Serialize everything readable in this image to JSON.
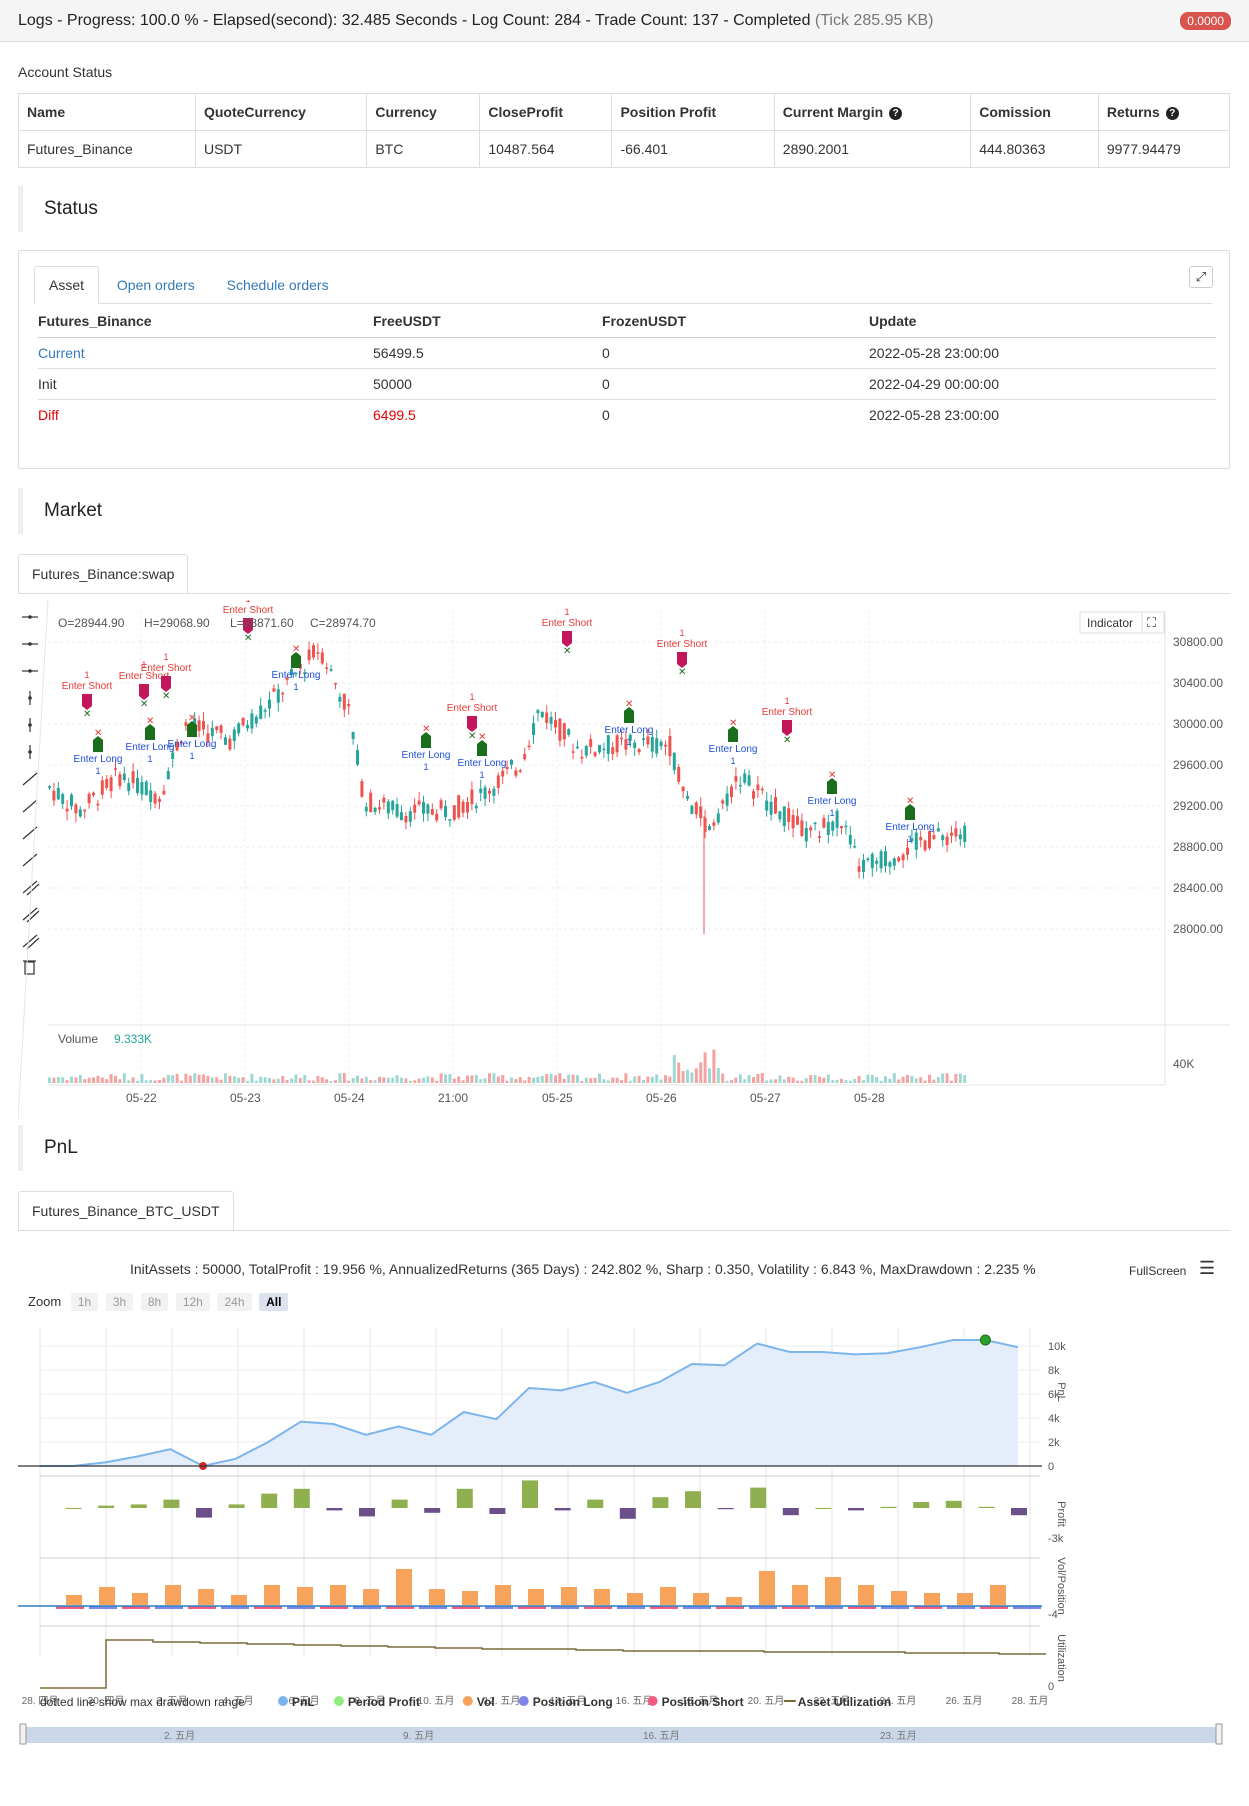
{
  "header": {
    "title": "Logs - Progress: 100.0 % - Elapsed(second): 32.485 Seconds - Log Count: 284 - Trade Count: 137 - Completed",
    "tick": "(Tick 285.95 KB)",
    "badge": "0.0000"
  },
  "account": {
    "label": "Account Status",
    "columns": [
      "Name",
      "QuoteCurrency",
      "Currency",
      "CloseProfit",
      "Position Profit",
      "Current Margin",
      "Comission",
      "Returns"
    ],
    "row": [
      "Futures_Binance",
      "USDT",
      "BTC",
      "10487.564",
      "-66.401",
      "2890.2001",
      "444.80363",
      "9977.94479"
    ]
  },
  "status": {
    "title": "Status",
    "tabs": [
      "Asset",
      "Open orders",
      "Schedule orders"
    ],
    "columns": [
      "Futures_Binance",
      "FreeUSDT",
      "FrozenUSDT",
      "Update"
    ],
    "rows": [
      [
        "Current",
        "56499.5",
        "0",
        "2022-05-28 23:00:00"
      ],
      [
        "Init",
        "50000",
        "0",
        "2022-04-29 00:00:00"
      ],
      [
        "Diff",
        "6499.5",
        "0",
        "2022-05-28 23:00:00"
      ]
    ],
    "colors": {
      "current": "#337ab7",
      "diff": "#e00000"
    }
  },
  "market": {
    "title": "Market",
    "tab": "Futures_Binance:swap",
    "ohlc": {
      "o": "O=28944.90",
      "h": "H=29068.90",
      "l": "L=28871.60",
      "c": "C=28974.70"
    },
    "indicator_label": "Indicator",
    "volume_label": "Volume",
    "volume_value": "9.333K",
    "price_ticks": [
      "30800.00",
      "30400.00",
      "30000.00",
      "29600.00",
      "29200.00",
      "28800.00",
      "28400.00",
      "28000.00"
    ],
    "volume_tick": "40K",
    "date_ticks": [
      "05-22",
      "05-23",
      "05-24",
      "21:00",
      "05-25",
      "05-26",
      "05-27",
      "05-28"
    ],
    "enter_short": "Enter Short",
    "enter_long": "Enter Long",
    "qty": "1",
    "colors": {
      "up": "#26a69a",
      "down": "#ef5350",
      "short_marker": "#c2185b",
      "long_marker": "#1b6e1b"
    }
  },
  "pnl": {
    "title": "PnL",
    "tab": "Futures_Binance_BTC_USDT",
    "summary": "InitAssets : 50000, TotalProfit : 19.956 %, AnnualizedReturns (365 Days) : 242.802 %, Sharp : 0.350, Volatility : 6.843 %, MaxDrawdown : 2.235 %",
    "fullscreen": "FullScreen",
    "zoom_label": "Zoom",
    "zoom_buttons": [
      "1h",
      "3h",
      "8h",
      "12h",
      "24h",
      "All"
    ],
    "y_ticks_pnl": [
      "10k",
      "8k",
      "6k",
      "4k",
      "2k",
      "0"
    ],
    "y_tick_profit": "-3k",
    "y_tick_vol": "-4",
    "y_tick_util": "0",
    "axis_titles": [
      "PnL",
      "Profit",
      "Vol/Position",
      "Utilization"
    ],
    "x_ticks": [
      "28. 四月",
      "30. 四月",
      "2. 五月",
      "4. 五月",
      "6. 五月",
      "8. 五月",
      "10. 五月",
      "12. 五月",
      "14. 五月",
      "16. 五月",
      "18. 五月",
      "20. 五月",
      "22. 五月",
      "24. 五月",
      "26. 五月",
      "28. 五月"
    ],
    "nav_ticks": [
      "2. 五月",
      "9. 五月",
      "16. 五月",
      "23. 五月"
    ],
    "footnote": "dotted line show max drawdown range",
    "legend": [
      {
        "name": "PnL",
        "color": "#7cb5ec"
      },
      {
        "name": "Period Profit",
        "color": "#90ed7d"
      },
      {
        "name": "Vol",
        "color": "#f7a35c"
      },
      {
        "name": "Position Long",
        "color": "#8085e9"
      },
      {
        "name": "Position Short",
        "color": "#f15c80"
      },
      {
        "name": "Asset Utilization",
        "color": "#7a6a3a"
      }
    ]
  },
  "chart_data": {
    "type": "area",
    "x": [
      "04-28",
      "04-30",
      "05-01",
      "05-02",
      "05-03",
      "05-04",
      "05-05",
      "05-06",
      "05-07",
      "05-08",
      "05-09",
      "05-10",
      "05-11",
      "05-12",
      "05-13",
      "05-14",
      "05-15",
      "05-16",
      "05-17",
      "05-18",
      "05-19",
      "05-20",
      "05-21",
      "05-22",
      "05-23",
      "05-24",
      "05-25",
      "05-26",
      "05-27",
      "05-28",
      "05-29"
    ],
    "series": [
      {
        "name": "PnL",
        "values": [
          0,
          0,
          300,
          800,
          1400,
          0,
          600,
          2000,
          3700,
          3500,
          2600,
          3300,
          2600,
          4500,
          3900,
          6500,
          6300,
          7000,
          6100,
          7000,
          8500,
          8400,
          10200,
          9500,
          9500,
          9300,
          9400,
          9900,
          10500,
          10500,
          9900
        ]
      },
      {
        "name": "Period Profit",
        "values": [
          0,
          0,
          200,
          300,
          700,
          -800,
          300,
          1200,
          1600,
          -200,
          -700,
          700,
          -400,
          1600,
          -500,
          2300,
          -200,
          700,
          -900,
          900,
          1400,
          -100,
          1700,
          -600,
          0,
          -200,
          100,
          500,
          600,
          100,
          -600
        ]
      }
    ],
    "ylim": [
      0,
      11000
    ]
  }
}
